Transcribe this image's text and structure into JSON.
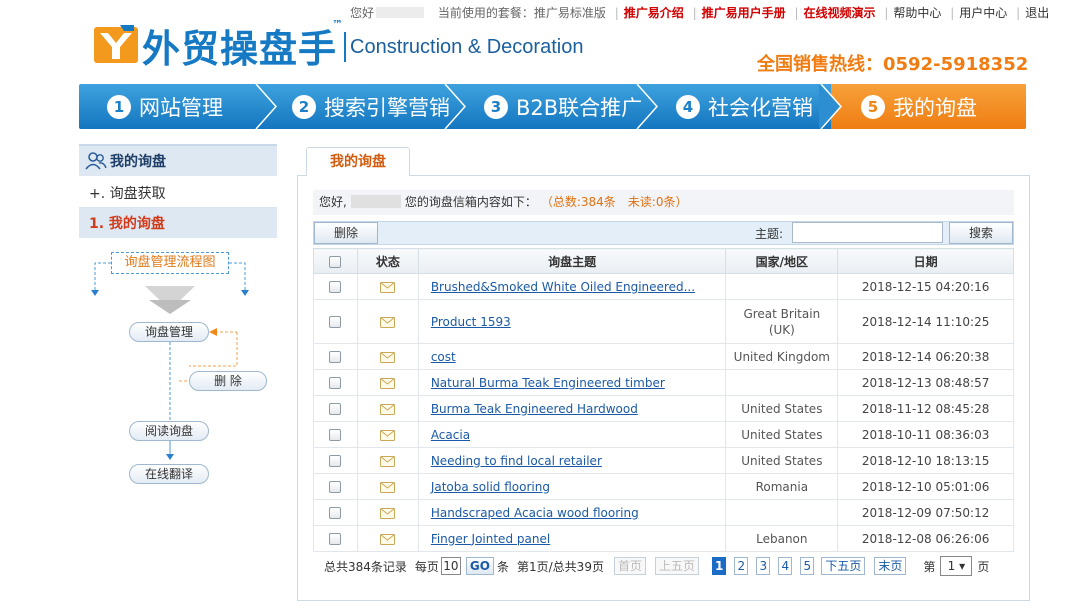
{
  "top": {
    "hello": "您好",
    "current_plan": "当前使用的套餐：推广易标准版",
    "links": [
      "推广易介绍",
      "推广易用户手册",
      "在线视频演示",
      "帮助中心",
      "用户中心",
      "退出"
    ]
  },
  "brand": {
    "name_cn": "外贸操盘手",
    "tm": "™",
    "name_en": "Construction & Decoration",
    "hotline": "全国销售热线：0592-5918352"
  },
  "colors": {
    "accent_blue": "#1679c3",
    "accent_orange": "#ef7d12",
    "link": "#1b5aa6",
    "highlight_red": "#d23a19"
  },
  "nav": [
    {
      "num": "1",
      "label": "网站管理"
    },
    {
      "num": "2",
      "label": "搜索引擎营销"
    },
    {
      "num": "3",
      "label": "B2B联合推广"
    },
    {
      "num": "4",
      "label": "社会化营销"
    },
    {
      "num": "5",
      "label": "我的询盘"
    }
  ],
  "sidebar": {
    "title": "我的询盘",
    "items": [
      "+. 询盘获取",
      "1. 我的询盘"
    ],
    "flow": {
      "title": "询盘管理流程图",
      "nodes": [
        "询盘管理",
        "删 除",
        "阅读询盘",
        "在线翻译"
      ]
    }
  },
  "content": {
    "tab": "我的询盘",
    "greeting_prefix": "您好,",
    "greeting_suffix": "您的询盘信箱内容如下：",
    "counts": "（总数:384条　未读:0条）",
    "delete_button": "删除",
    "subject_label": "主题:",
    "search_button": "搜索",
    "columns": [
      "状态",
      "询盘主题",
      "国家/地区",
      "日期"
    ],
    "rows": [
      {
        "subject": "Brushed&Smoked White Oiled Engineered...",
        "country": "",
        "date": "2018-12-15 04:20:16"
      },
      {
        "subject": "Product 1593",
        "country": "Great Britain (UK)",
        "date": "2018-12-14 11:10:25"
      },
      {
        "subject": "cost",
        "country": "United Kingdom",
        "date": "2018-12-14 06:20:38"
      },
      {
        "subject": "Natural Burma Teak Engineered timber",
        "country": "",
        "date": "2018-12-13 08:48:57"
      },
      {
        "subject": "Burma Teak Engineered Hardwood",
        "country": "United States",
        "date": "2018-11-12 08:45:28"
      },
      {
        "subject": "Acacia",
        "country": "United States",
        "date": "2018-10-11 08:36:03"
      },
      {
        "subject": "Needing to find local retailer",
        "country": "United States",
        "date": "2018-12-10 18:13:15"
      },
      {
        "subject": "Jatoba solid flooring",
        "country": "Romania",
        "date": "2018-12-10 05:01:06"
      },
      {
        "subject": "Handscraped Acacia wood flooring",
        "country": "",
        "date": "2018-12-09 07:50:12"
      },
      {
        "subject": "Finger Jointed panel",
        "country": "Lebanon",
        "date": "2018-12-08 06:26:06"
      }
    ]
  },
  "pager": {
    "total": "总共384条记录",
    "per_page_prefix": "每页",
    "per_page": "10",
    "go": "GO",
    "per_page_suffix": "条",
    "page_info": "第1页/总共39页",
    "first": "首页",
    "prev5": "上五页",
    "pages": [
      "1",
      "2",
      "3",
      "4",
      "5"
    ],
    "next5": "下五页",
    "last": "末页",
    "jump_prefix": "第",
    "jump_value": "1 ▾",
    "jump_suffix": "页"
  }
}
